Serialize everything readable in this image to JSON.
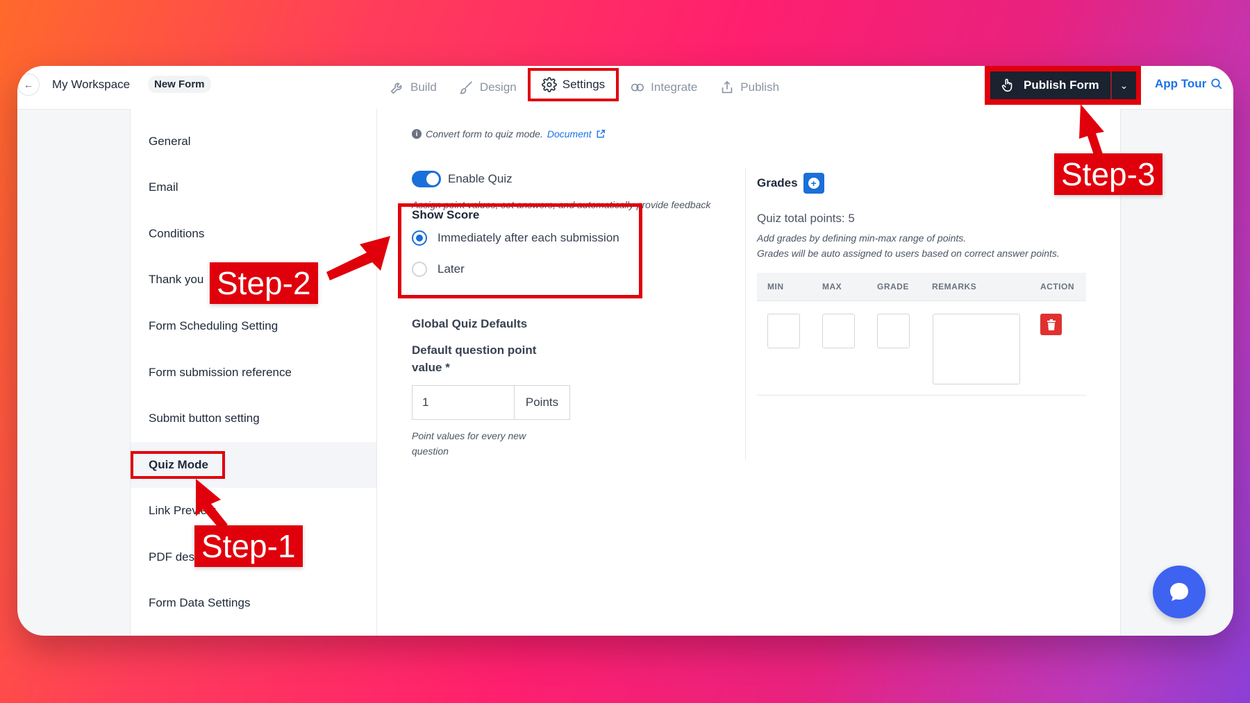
{
  "topbar": {
    "workspace": "My Workspace",
    "form_name": "New Form",
    "tabs": [
      {
        "label": "Build",
        "icon": "wrench-icon"
      },
      {
        "label": "Design",
        "icon": "brush-icon"
      },
      {
        "label": "Settings",
        "icon": "gear-icon"
      },
      {
        "label": "Integrate",
        "icon": "link-icon"
      },
      {
        "label": "Publish",
        "icon": "share-icon"
      }
    ],
    "publish_button": "Publish Form",
    "app_tour": "App Tour"
  },
  "sidebar": {
    "items": [
      {
        "label": "General"
      },
      {
        "label": "Email"
      },
      {
        "label": "Conditions"
      },
      {
        "label": "Thank you"
      },
      {
        "label": "Form Scheduling Setting"
      },
      {
        "label": "Form submission reference"
      },
      {
        "label": "Submit button setting"
      },
      {
        "label": "Quiz Mode"
      },
      {
        "label": "Link Preview"
      },
      {
        "label": "PDF design"
      },
      {
        "label": "Form Data Settings"
      }
    ],
    "active": "Quiz Mode"
  },
  "quiz": {
    "note_text": "Convert form to quiz mode.",
    "note_link": "Document",
    "enable_label": "Enable Quiz",
    "enable_on": true,
    "assign_note": "Assign point values, set answers, and automatically provide feedback",
    "show_score_title": "Show Score",
    "score_options": [
      "Immediately after each submission",
      "Later"
    ],
    "score_selected": "Immediately after each submission",
    "defaults_title": "Global Quiz Defaults",
    "default_point_label": "Default question point value *",
    "default_point_value": "1",
    "points_unit": "Points",
    "point_note": "Point values for every new question"
  },
  "grades": {
    "title": "Grades",
    "total_points": "Quiz total points: 5",
    "help_line1": "Add grades by defining min-max range of points.",
    "help_line2": "Grades will be auto assigned to users based on correct answer points.",
    "columns": [
      "MIN",
      "MAX",
      "GRADE",
      "REMARKS",
      "ACTION"
    ]
  },
  "annotations": {
    "step1": "Step-1",
    "step2": "Step-2",
    "step3": "Step-3"
  },
  "colors": {
    "accent": "#1a6fd8",
    "annotation_red": "#e0000b",
    "publish_dark": "#1b2230"
  }
}
